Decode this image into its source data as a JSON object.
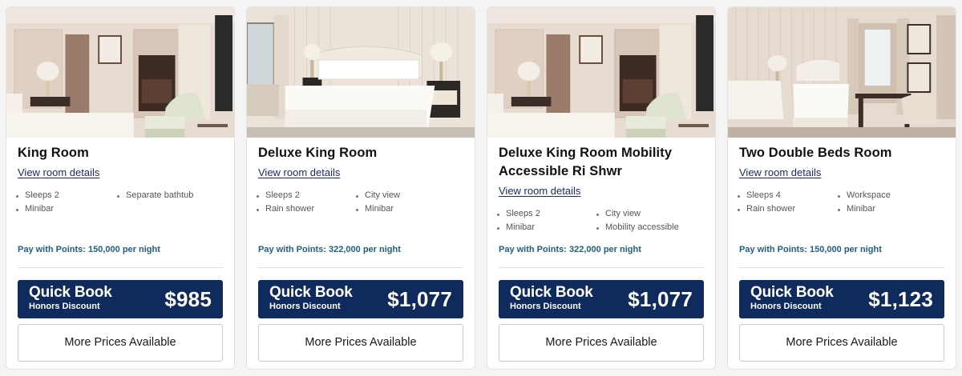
{
  "rooms": [
    {
      "name": "King Room",
      "details_link": "View room details",
      "amenities": [
        "Sleeps 2",
        "Separate bathtub",
        "Minibar"
      ],
      "points": "Pay with Points: 150,000 per night",
      "quick_book": "Quick Book",
      "discount": "Honors Discount",
      "price": "$985",
      "more_prices": "More Prices Available"
    },
    {
      "name": "Deluxe King Room",
      "details_link": "View room details",
      "amenities": [
        "Sleeps 2",
        "City view",
        "Rain shower",
        "Minibar"
      ],
      "points": "Pay with Points: 322,000 per night",
      "quick_book": "Quick Book",
      "discount": "Honors Discount",
      "price": "$1,077",
      "more_prices": "More Prices Available"
    },
    {
      "name": "Deluxe King Room Mobility Accessible Ri Shwr",
      "details_link": "View room details",
      "amenities": [
        "Sleeps 2",
        "City view",
        "Minibar",
        "Mobility accessible"
      ],
      "points": "Pay with Points: 322,000 per night",
      "quick_book": "Quick Book",
      "discount": "Honors Discount",
      "price": "$1,077",
      "more_prices": "More Prices Available"
    },
    {
      "name": "Two Double Beds Room",
      "details_link": "View room details",
      "amenities": [
        "Sleeps 4",
        "Workspace",
        "Rain shower",
        "Minibar"
      ],
      "points": "Pay with Points: 150,000 per night",
      "quick_book": "Quick Book",
      "discount": "Honors Discount",
      "price": "$1,123",
      "more_prices": "More Prices Available"
    }
  ]
}
